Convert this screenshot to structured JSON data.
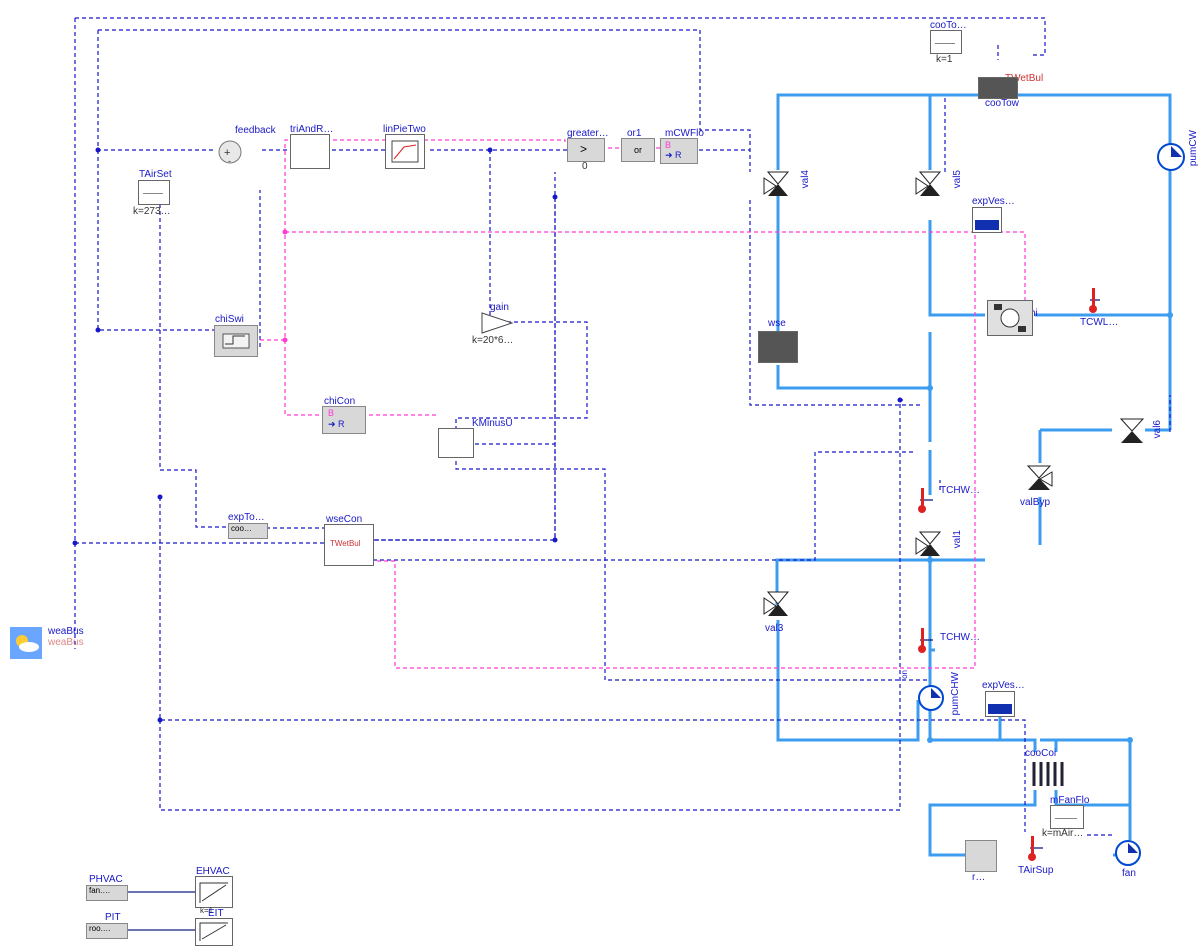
{
  "labels": {
    "weaBus": "weaBus",
    "weabus2": "weaBus",
    "TAirSet": "TAirSet",
    "TAirSet_k": "k=273…",
    "feedback": "feedback",
    "triAndR": "triAndR…",
    "linPieTwo": "linPieTwo",
    "greater": "greater…",
    "greater0": "0",
    "or1": "or1",
    "mCWFlo": "mCWFlo",
    "cooTo": "cooTo…",
    "cooTo_k": "k=1",
    "TWetBul": "TWetBul",
    "cooTow": "cooTow",
    "pumCW": "pumCW",
    "val4": "val4",
    "val5": "val5",
    "expVes": "expVes…",
    "TCWL": "TCWL…",
    "chiSwi": "chiSwi",
    "gain": "gain",
    "gain_k": "k=20*6…",
    "wse": "wse",
    "chi": "chi",
    "chiCon": "chiCon",
    "KMinusU": "KMinusU",
    "val6": "val6",
    "valByp": "valByp",
    "TCHW": "TCHW…",
    "val1": "val1",
    "val3": "val3",
    "TCHW2": "TCHW…",
    "expTo": "expTo…",
    "coo": "coo…",
    "wseCon": "wseCon",
    "TWetb2": "TWetBul",
    "pumCHW": "pumCHW",
    "on": "on",
    "expVes2": "expVes…",
    "cooCoi": "cooCoi",
    "mFanFlo": "mFanFlo",
    "mFanFlo_k": "k=mAir…",
    "TAirSup": "TAirSup",
    "fan": "fan",
    "r": "r…",
    "PHVAC": "PHVAC",
    "PHVAC_fan": "fan.…",
    "EHVAC": "EHVAC",
    "PIT": "PIT",
    "PIT_roo": "roo.…",
    "EIT": "EIT",
    "k1": "k=1",
    "B": "B",
    "toR": "➜ R",
    "or": "or",
    "gt": ">"
  }
}
